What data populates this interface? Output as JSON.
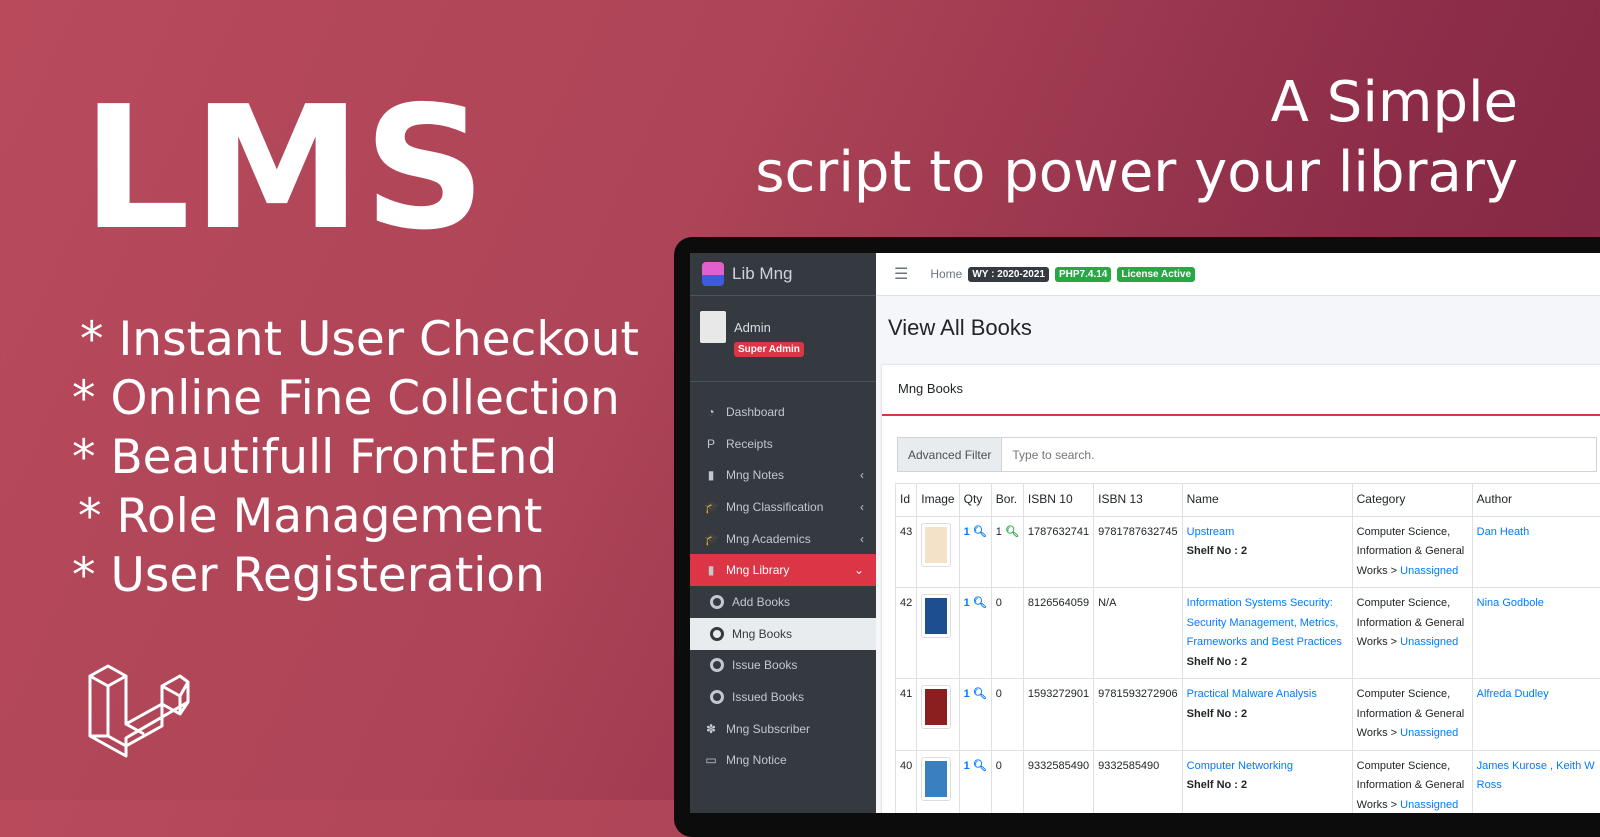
{
  "hero": {
    "title": "LMS",
    "tagline_1": "A Simple",
    "tagline_2": "script to power your library",
    "features": [
      "* Instant User Checkout",
      "* Online Fine Collection",
      "* Beautifull FrontEnd",
      "* Role Management",
      "* User Registeration"
    ]
  },
  "app": {
    "brand": "Lib Mng",
    "user": {
      "name": "Admin",
      "role": "Super Admin"
    },
    "nav": [
      {
        "label": "Dashboard",
        "icon": "dashboard-icon",
        "chev": ""
      },
      {
        "label": "Receipts",
        "icon": "paypal-icon",
        "chev": ""
      },
      {
        "label": "Mng Notes",
        "icon": "reader-icon",
        "chev": "‹"
      },
      {
        "label": "Mng Classification",
        "icon": "graduation-cap-icon",
        "chev": "‹"
      },
      {
        "label": "Mng Academics",
        "icon": "graduation-cap-icon",
        "chev": "‹"
      },
      {
        "label": "Mng Library",
        "icon": "book-icon",
        "chev": "⌄"
      },
      {
        "label": "Add Books",
        "icon": "circle-icon"
      },
      {
        "label": "Mng Books",
        "icon": "circle-icon"
      },
      {
        "label": "Issue Books",
        "icon": "circle-icon"
      },
      {
        "label": "Issued Books",
        "icon": "circle-icon"
      },
      {
        "label": "Mng Subscriber",
        "icon": "paw-icon",
        "chev": ""
      },
      {
        "label": "Mng Notice",
        "icon": "notice-icon",
        "chev": ""
      }
    ],
    "topbar": {
      "home": "Home",
      "wy": "WY : 2020-2021",
      "php": "PHP7.4.14",
      "license": "License Active"
    },
    "page_title": "View All Books",
    "card_title": "Mng Books",
    "filter": {
      "label": "Advanced Filter",
      "placeholder": "Type to search."
    },
    "table": {
      "headers": [
        "Id",
        "Image",
        "Qty",
        "Bor.",
        "ISBN 10",
        "ISBN 13",
        "Name",
        "Category",
        "Author"
      ],
      "rows": [
        {
          "id": "43",
          "qty": "1",
          "bor": "1",
          "isbn10": "1787632741",
          "isbn13": "9781787632745",
          "name": "Upstream",
          "shelf": "Shelf No : 2",
          "category": "Computer Science, Information & General Works",
          "sub": "Unassigned",
          "author": "Dan Heath",
          "cover": "#f3e2c8"
        },
        {
          "id": "42",
          "qty": "1",
          "bor": "0",
          "isbn10": "8126564059",
          "isbn13": "N/A",
          "name": "Information Systems Security: Security Management, Metrics, Frameworks and Best Practices",
          "shelf": "Shelf No : 2",
          "category": "Computer Science, Information & General Works",
          "sub": "Unassigned",
          "author": "Nina Godbole",
          "cover": "#1d4f8f"
        },
        {
          "id": "41",
          "qty": "1",
          "bor": "0",
          "isbn10": "1593272901",
          "isbn13": "9781593272906",
          "name": "Practical Malware Analysis",
          "shelf": "Shelf No : 2",
          "category": "Computer Science, Information & General Works",
          "sub": "Unassigned",
          "author": "Alfreda Dudley",
          "cover": "#8b1e1e"
        },
        {
          "id": "40",
          "qty": "1",
          "bor": "0",
          "isbn10": "9332585490",
          "isbn13": "9332585490",
          "name": "Computer Networking",
          "shelf": "Shelf No : 2",
          "category": "Computer Science, Information & General Works",
          "sub": "Unassigned",
          "author": "James Kurose , Keith W Ross",
          "cover": "#3a7fc0"
        }
      ]
    }
  }
}
